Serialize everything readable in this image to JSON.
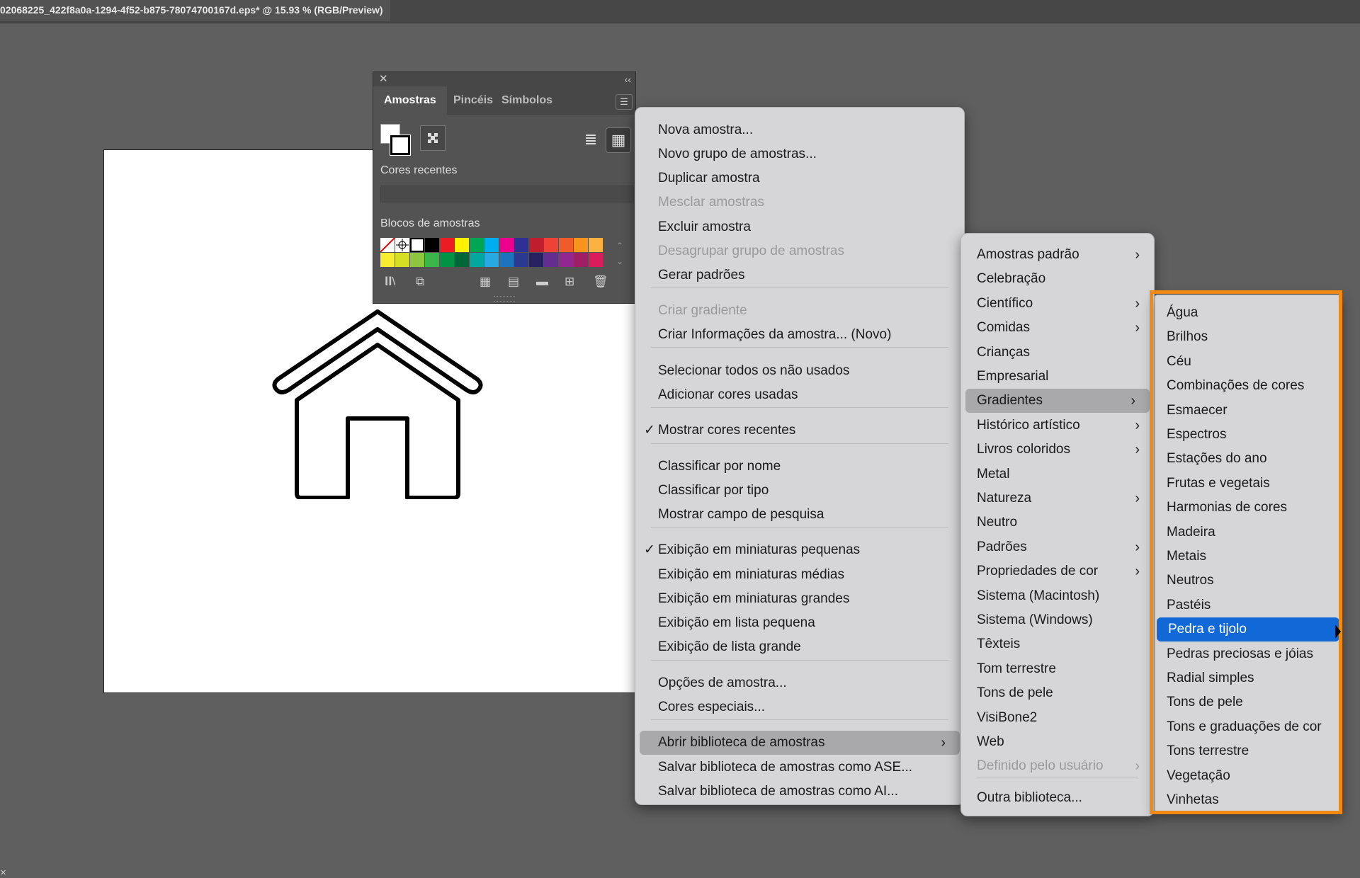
{
  "window": {
    "title": "02068225_422f8a0a-1294-4f52-b875-78074700167d.eps* @ 15.93 % (RGB/Preview)"
  },
  "panel": {
    "tabs": [
      "Amostras",
      "Pincéis",
      "Símbolos"
    ],
    "recent_label": "Cores recentes",
    "blocks_label": "Blocos de amostras",
    "swatch_colors_row1": [
      "none",
      "reg",
      "#ffffff",
      "#000000",
      "#ed1c24",
      "#fff200",
      "#00a651",
      "#00aeef",
      "#ec008c",
      "#2e3192",
      "#be1e2d",
      "#ef4136",
      "#f15a29",
      "#f7941d",
      "#fbb040"
    ],
    "swatch_colors_row2": [
      "#f9ed32",
      "#d7df23",
      "#8dc63f",
      "#39b54a",
      "#009444",
      "#006838",
      "#00a79d",
      "#27aae1",
      "#1c75bc",
      "#2b3990",
      "#262262",
      "#662d91",
      "#92278f",
      "#9e1f63",
      "#da1c5c"
    ]
  },
  "menu1": {
    "items": [
      {
        "label": "Nova amostra...",
        "state": ""
      },
      {
        "label": "Novo grupo de amostras...",
        "state": ""
      },
      {
        "label": "Duplicar amostra",
        "state": ""
      },
      {
        "label": "Mesclar amostras",
        "state": "disabled"
      },
      {
        "label": "Excluir amostra",
        "state": ""
      },
      {
        "label": "Desagrupar grupo de amostras",
        "state": "disabled"
      },
      {
        "label": "Gerar padrões",
        "state": ""
      },
      {
        "label": "Criar gradiente",
        "state": "disabled"
      },
      {
        "label": "Criar Informações da amostra... (Novo)",
        "state": ""
      },
      {
        "label": "Selecionar todos os não usados",
        "state": ""
      },
      {
        "label": "Adicionar cores usadas",
        "state": ""
      },
      {
        "label": "Mostrar cores recentes",
        "state": "checked"
      },
      {
        "label": "Classificar por nome",
        "state": ""
      },
      {
        "label": "Classificar por tipo",
        "state": ""
      },
      {
        "label": "Mostrar campo de pesquisa",
        "state": ""
      },
      {
        "label": "Exibição em miniaturas pequenas",
        "state": "checked"
      },
      {
        "label": "Exibição em miniaturas médias",
        "state": ""
      },
      {
        "label": "Exibição em miniaturas grandes",
        "state": ""
      },
      {
        "label": "Exibição em lista pequena",
        "state": ""
      },
      {
        "label": "Exibição de lista grande",
        "state": ""
      },
      {
        "label": "Opções de amostra...",
        "state": ""
      },
      {
        "label": "Cores especiais...",
        "state": ""
      },
      {
        "label": "Abrir biblioteca de amostras",
        "state": "selected"
      },
      {
        "label": "Salvar biblioteca de amostras como ASE...",
        "state": ""
      },
      {
        "label": "Salvar biblioteca de amostras como AI...",
        "state": ""
      }
    ]
  },
  "menu2": {
    "items": [
      {
        "label": "Amostras padrão",
        "state": "",
        "submenu": true
      },
      {
        "label": "Celebração",
        "state": "",
        "submenu": false
      },
      {
        "label": "Científico",
        "state": "",
        "submenu": true
      },
      {
        "label": "Comidas",
        "state": "",
        "submenu": true
      },
      {
        "label": "Crianças",
        "state": "",
        "submenu": false
      },
      {
        "label": "Empresarial",
        "state": "",
        "submenu": false
      },
      {
        "label": "Gradientes",
        "state": "selected",
        "submenu": true
      },
      {
        "label": "Histórico artístico",
        "state": "",
        "submenu": true
      },
      {
        "label": "Livros coloridos",
        "state": "",
        "submenu": true
      },
      {
        "label": "Metal",
        "state": "",
        "submenu": false
      },
      {
        "label": "Natureza",
        "state": "",
        "submenu": true
      },
      {
        "label": "Neutro",
        "state": "",
        "submenu": false
      },
      {
        "label": "Padrões",
        "state": "",
        "submenu": true
      },
      {
        "label": "Propriedades de cor",
        "state": "",
        "submenu": true
      },
      {
        "label": "Sistema (Macintosh)",
        "state": "",
        "submenu": false
      },
      {
        "label": "Sistema (Windows)",
        "state": "",
        "submenu": false
      },
      {
        "label": "Têxteis",
        "state": "",
        "submenu": false
      },
      {
        "label": "Tom terrestre",
        "state": "",
        "submenu": false
      },
      {
        "label": "Tons de pele",
        "state": "",
        "submenu": false
      },
      {
        "label": "VisiBone2",
        "state": "",
        "submenu": false
      },
      {
        "label": "Web",
        "state": "",
        "submenu": false
      },
      {
        "label": "Definido pelo usuário",
        "state": "disabled",
        "submenu": true
      },
      {
        "label": "Outra biblioteca...",
        "state": "",
        "submenu": false
      }
    ]
  },
  "menu3": {
    "items": [
      {
        "label": "Água",
        "state": ""
      },
      {
        "label": "Brilhos",
        "state": ""
      },
      {
        "label": "Céu",
        "state": ""
      },
      {
        "label": "Combinações de cores",
        "state": ""
      },
      {
        "label": "Esmaecer",
        "state": ""
      },
      {
        "label": "Espectros",
        "state": ""
      },
      {
        "label": "Estações do ano",
        "state": ""
      },
      {
        "label": "Frutas e vegetais",
        "state": ""
      },
      {
        "label": "Harmonias de cores",
        "state": ""
      },
      {
        "label": "Madeira",
        "state": ""
      },
      {
        "label": "Metais",
        "state": ""
      },
      {
        "label": "Neutros",
        "state": ""
      },
      {
        "label": "Pastéis",
        "state": ""
      },
      {
        "label": "Pedra e tijolo",
        "state": "highlighted"
      },
      {
        "label": "Pedras preciosas e jóias",
        "state": ""
      },
      {
        "label": "Radial simples",
        "state": ""
      },
      {
        "label": "Tons de pele",
        "state": ""
      },
      {
        "label": "Tons e graduações de cor",
        "state": ""
      },
      {
        "label": "Tons terrestre",
        "state": ""
      },
      {
        "label": "Vegetação",
        "state": ""
      },
      {
        "label": "Vinhetas",
        "state": ""
      }
    ]
  },
  "colors": {
    "highlight": "#1169d8",
    "annotation": "#f08a12"
  }
}
